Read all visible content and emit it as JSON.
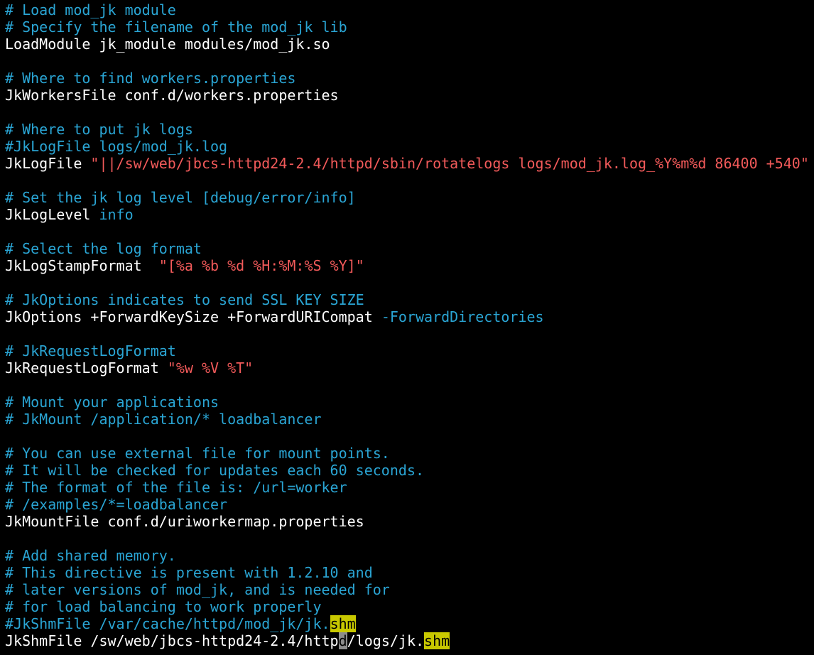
{
  "colors": {
    "background": "#000000",
    "comment": "#2aa5d4",
    "plain": "#ffffff",
    "string": "#f25a5a",
    "keyword": "#2aa5d4",
    "search_highlight": "#c8c800",
    "cursor": "#8c8c8c"
  },
  "editor": {
    "lines": [
      [
        {
          "t": "# Load mod_jk module",
          "c": "comment"
        }
      ],
      [
        {
          "t": "# Specify the filename of the mod_jk lib",
          "c": "comment"
        }
      ],
      [
        {
          "t": "LoadModule jk_module modules/mod_jk.so",
          "c": "plain"
        }
      ],
      [],
      [
        {
          "t": "# Where to find workers.properties",
          "c": "comment"
        }
      ],
      [
        {
          "t": "JkWorkersFile conf.d/workers.properties",
          "c": "plain"
        }
      ],
      [],
      [
        {
          "t": "# Where to put jk logs",
          "c": "comment"
        }
      ],
      [
        {
          "t": "#JkLogFile logs/mod_jk.log",
          "c": "comment"
        }
      ],
      [
        {
          "t": "JkLogFile ",
          "c": "plain"
        },
        {
          "t": "\"||/sw/web/jbcs-httpd24-2.4/httpd/sbin/rotatelogs logs/mod_jk.log_%Y%m%d 86400 +540\"",
          "c": "string"
        }
      ],
      [],
      [
        {
          "t": "# Set the jk log level [debug/error/info]",
          "c": "comment"
        }
      ],
      [
        {
          "t": "JkLogLevel ",
          "c": "plain"
        },
        {
          "t": "info",
          "c": "keyword"
        }
      ],
      [],
      [
        {
          "t": "# Select the log format",
          "c": "comment"
        }
      ],
      [
        {
          "t": "JkLogStampFormat  ",
          "c": "plain"
        },
        {
          "t": "\"[%a %b %d %H:%M:%S %Y]\"",
          "c": "string"
        }
      ],
      [],
      [
        {
          "t": "# JkOptions indicates to send SSL KEY SIZE",
          "c": "comment"
        }
      ],
      [
        {
          "t": "JkOptions +ForwardKeySize +ForwardURICompat ",
          "c": "plain"
        },
        {
          "t": "-ForwardDirectories",
          "c": "keyword"
        }
      ],
      [],
      [
        {
          "t": "# JkRequestLogFormat",
          "c": "comment"
        }
      ],
      [
        {
          "t": "JkRequestLogFormat ",
          "c": "plain"
        },
        {
          "t": "\"%w %V %T\"",
          "c": "string"
        }
      ],
      [],
      [
        {
          "t": "# Mount your applications",
          "c": "comment"
        }
      ],
      [
        {
          "t": "# JkMount /application/* loadbalancer",
          "c": "comment"
        }
      ],
      [],
      [
        {
          "t": "# You can use external file for mount points.",
          "c": "comment"
        }
      ],
      [
        {
          "t": "# It will be checked for updates each 60 seconds.",
          "c": "comment"
        }
      ],
      [
        {
          "t": "# The format of the file is: /url=worker",
          "c": "comment"
        }
      ],
      [
        {
          "t": "# /examples/*=loadbalancer",
          "c": "comment"
        }
      ],
      [
        {
          "t": "JkMountFile conf.d/uriworkermap.properties",
          "c": "plain"
        }
      ],
      [],
      [
        {
          "t": "# Add shared memory.",
          "c": "comment"
        }
      ],
      [
        {
          "t": "# This directive is present with 1.2.10 and",
          "c": "comment"
        }
      ],
      [
        {
          "t": "# later versions of mod_jk, and is needed for",
          "c": "comment"
        }
      ],
      [
        {
          "t": "# for load balancing to work properly",
          "c": "comment"
        }
      ],
      [
        {
          "t": "#JkShmFile /var/cache/httpd/mod_jk/jk.",
          "c": "comment"
        },
        {
          "t": "shm",
          "c": "hl"
        }
      ],
      [
        {
          "t": "JkShmFile /sw/web/jbcs-httpd24-2.4/http",
          "c": "plain"
        },
        {
          "t": "d",
          "c": "cursor"
        },
        {
          "t": "/logs/jk.",
          "c": "plain"
        },
        {
          "t": "shm",
          "c": "hl"
        }
      ]
    ]
  }
}
